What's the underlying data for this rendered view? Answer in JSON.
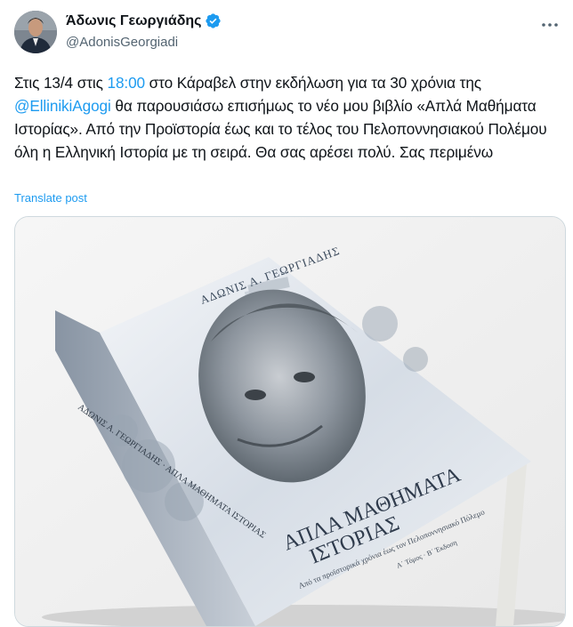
{
  "author": {
    "display_name": "Άδωνις Γεωργιάδης",
    "handle": "@AdonisGeorgiadi",
    "verified_icon": "verified-badge-icon",
    "verified_color": "#1d9bf0"
  },
  "tweet": {
    "parts": [
      "Στις 13/4 στις ",
      "18:00",
      " στο Κάραβελ στην εκδήλωση για τα 30 χρόνια της ",
      "@EllinikiAgogi",
      " θα παρουσιάσω επισήμως το νέο μου βιβλίο «Απλά Μαθήματα Ιστορίας». Από την Προϊστορία έως και το τέλος του Πελοποννησιακού Πολέμου όλη η Ελληνική Ιστορία με τη σειρά. Θα σας αρέσει πολύ. Σας περιμένω"
    ],
    "translate_label": "Translate post",
    "link_color": "#1d9bf0"
  },
  "book": {
    "author_on_cover": "ΑΔΩΝΙΣ Α. ΓΕΩΡΓΙΑΔΗΣ",
    "title_line1": "ΑΠΛΑ ΜΑΘΗΜΑΤΑ",
    "title_line2": "ΙΣΤΟΡΙΑΣ",
    "subtitle": "Από τα προϊστορικά χρόνια έως τον Πελοποννησιακό Πόλεμο",
    "edition": "Α΄ Τόμος · Β΄ Έκδοση",
    "spine_text": "ΑΔΩΝΙΣ Α. ΓΕΩΡΓΙΑΔΗΣ · ΑΠΛΑ ΜΑΘΗΜΑΤΑ ΙΣΤΟΡΙΑΣ"
  },
  "icons": {
    "more": "more-options-icon"
  }
}
